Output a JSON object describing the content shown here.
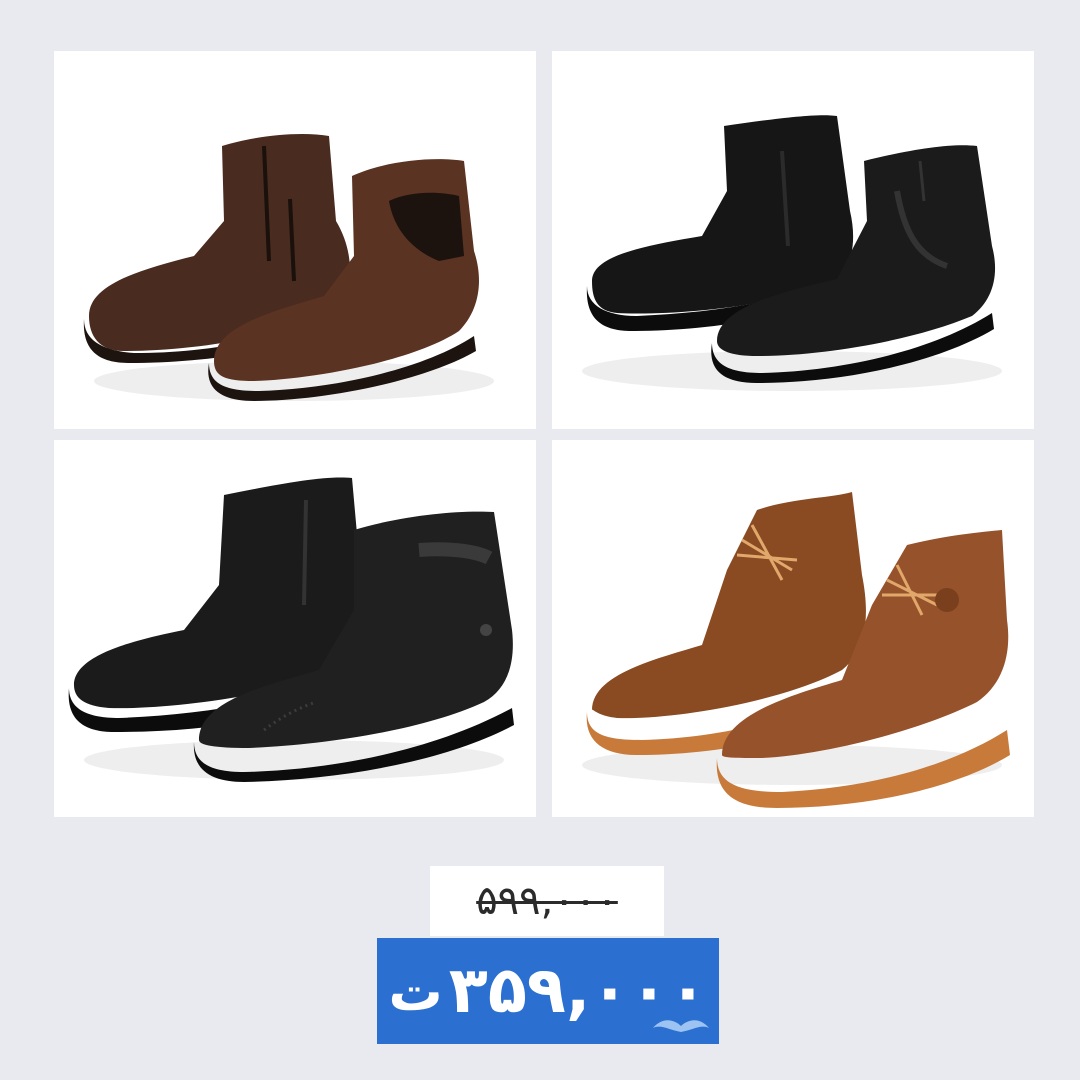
{
  "products": [
    {
      "name": "brown-leather-zip-boots",
      "sole_color": "#1a1a1a",
      "upper_color": "#4a2b1f"
    },
    {
      "name": "black-leather-zip-boots",
      "sole_color": "#111111",
      "upper_color": "#161616"
    },
    {
      "name": "black-brogue-zip-boots",
      "sole_color": "#111111",
      "upper_color": "#1b1b1b"
    },
    {
      "name": "tan-lace-up-wingtip-boots",
      "sole_color": "#c87a3a",
      "upper_color": "#8a4a22"
    }
  ],
  "pricing": {
    "old_price": "۵۹۹,۰۰۰",
    "new_price": "۳۵۹,۰۰۰",
    "currency": "ت"
  },
  "colors": {
    "background": "#e9eaef",
    "price_badge": "#2b6fd0"
  }
}
